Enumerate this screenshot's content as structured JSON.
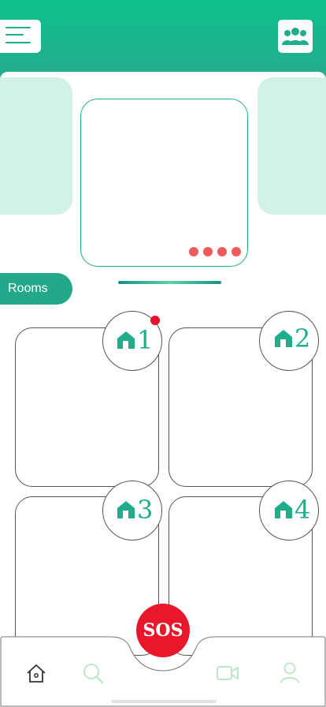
{
  "header": {
    "menu_icon": "hamburger-menu-icon",
    "group_icon": "users-group-icon"
  },
  "carousel": {
    "pagination_dots": 4,
    "dot_color": "#f15a5a"
  },
  "rooms": {
    "label": "Rooms",
    "items": [
      {
        "number": "1",
        "icon": "home-icon",
        "has_notification": true
      },
      {
        "number": "2",
        "icon": "home-icon",
        "has_notification": false
      },
      {
        "number": "3",
        "icon": "home-icon",
        "has_notification": false
      },
      {
        "number": "4",
        "icon": "home-icon",
        "has_notification": false
      }
    ]
  },
  "sos": {
    "label": "SOS",
    "color": "#e8172c"
  },
  "tabbar": {
    "items": [
      {
        "name": "home",
        "icon": "home-icon"
      },
      {
        "name": "search",
        "icon": "search-icon"
      },
      {
        "name": "video",
        "icon": "video-camera-icon"
      },
      {
        "name": "profile",
        "icon": "user-icon"
      }
    ]
  },
  "colors": {
    "accent": "#1fae8c",
    "header_gradient": [
      "#0dbf8a",
      "#2aa890"
    ],
    "carousel_side": "#d2f1e7"
  }
}
